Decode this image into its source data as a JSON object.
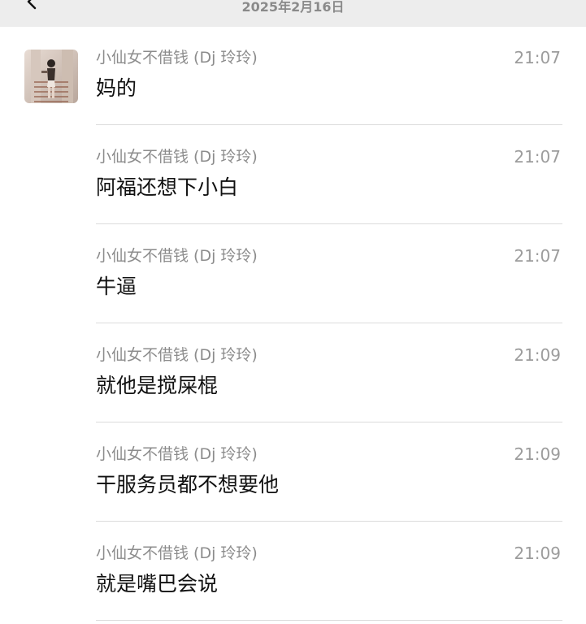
{
  "header": {
    "date": "2025年2月16日"
  },
  "messages": [
    {
      "sender": "小仙女不借钱 (Dj 玲玲)",
      "time": "21:07",
      "text": "妈的"
    },
    {
      "sender": "小仙女不借钱 (Dj 玲玲)",
      "time": "21:07",
      "text": "阿福还想下小白"
    },
    {
      "sender": "小仙女不借钱 (Dj 玲玲)",
      "time": "21:07",
      "text": "牛逼"
    },
    {
      "sender": "小仙女不借钱 (Dj 玲玲)",
      "time": "21:09",
      "text": "就他是搅屎棍"
    },
    {
      "sender": "小仙女不借钱 (Dj 玲玲)",
      "time": "21:09",
      "text": "干服务员都不想要他"
    },
    {
      "sender": "小仙女不借钱 (Dj 玲玲)",
      "time": "21:09",
      "text": "就是嘴巴会说"
    }
  ]
}
